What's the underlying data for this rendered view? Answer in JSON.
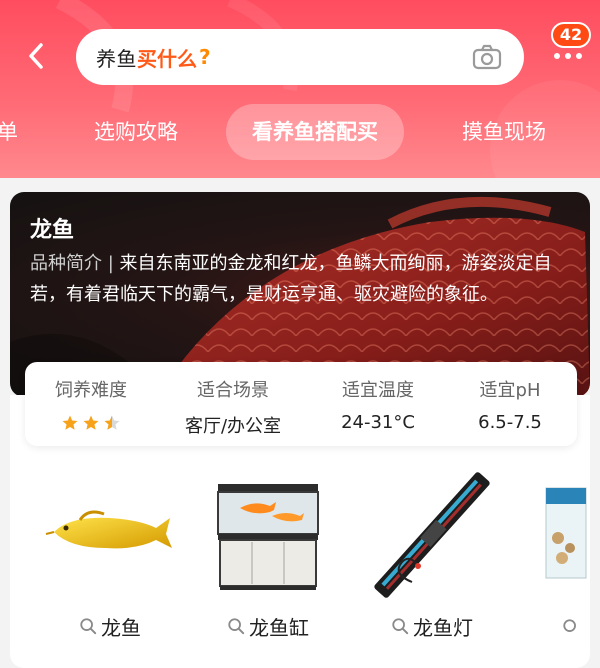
{
  "header": {
    "search": {
      "text_prefix": "养鱼",
      "text_highlight": "买什么",
      "text_mark": "?"
    },
    "notification_count": "42"
  },
  "tabs": [
    {
      "label": "清单"
    },
    {
      "label": "选购攻略"
    },
    {
      "label": "看养鱼搭配买",
      "active": true
    },
    {
      "label": "摸鱼现场"
    }
  ],
  "fish": {
    "name": "龙鱼",
    "intro_label": "品种简介 | ",
    "intro_text": "来自东南亚的金龙和红龙，鱼鳞大而绚丽，游姿淡定自若，有着君临天下的霸气，是财运亨通、驱灾避险的象征。"
  },
  "stats": {
    "difficulty": {
      "label": "饲养难度",
      "rating": 2.5,
      "max": 3
    },
    "scene": {
      "label": "适合场景",
      "value": "客厅/办公室"
    },
    "temperature": {
      "label": "适宜温度",
      "value": "24-31°C"
    },
    "ph": {
      "label": "适宜pH",
      "value": "6.5-7.5"
    }
  },
  "products": [
    {
      "label": "龙鱼",
      "icon": "arowana-fish-image"
    },
    {
      "label": "龙鱼缸",
      "icon": "fish-tank-image"
    },
    {
      "label": "龙鱼灯",
      "icon": "aquarium-lamp-image"
    }
  ],
  "colors": {
    "header_gradient_top": "#ff4d5f",
    "header_gradient_bottom": "#ff8a8f",
    "search_highlight": "#ff5a17",
    "badge": "#ff4a14",
    "star": "#f7a21b"
  }
}
